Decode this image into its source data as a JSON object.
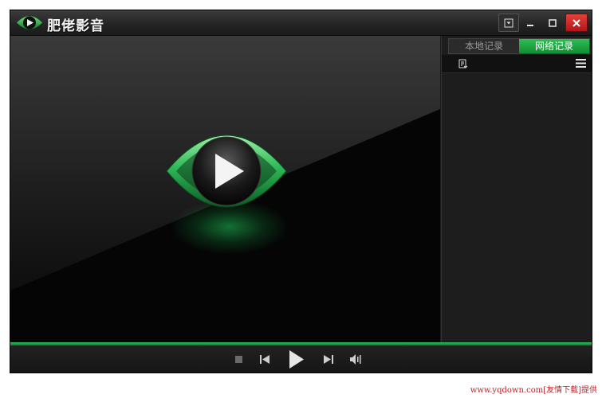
{
  "app": {
    "title": "肥佬影音"
  },
  "sidebar": {
    "tabs": [
      {
        "label": "本地记录",
        "active": false
      },
      {
        "label": "网络记录",
        "active": true
      }
    ]
  },
  "watermark": "www.yqdown.com[友情下载]提供",
  "colors": {
    "accent": "#1fae49",
    "close": "#d0282c"
  },
  "icons": [
    "app-logo-icon",
    "dropdown-icon",
    "minimize-icon",
    "maximize-icon",
    "close-icon",
    "big-play-icon",
    "add-file-icon",
    "list-menu-icon",
    "stop-icon",
    "previous-icon",
    "play-icon",
    "next-icon",
    "volume-icon"
  ]
}
